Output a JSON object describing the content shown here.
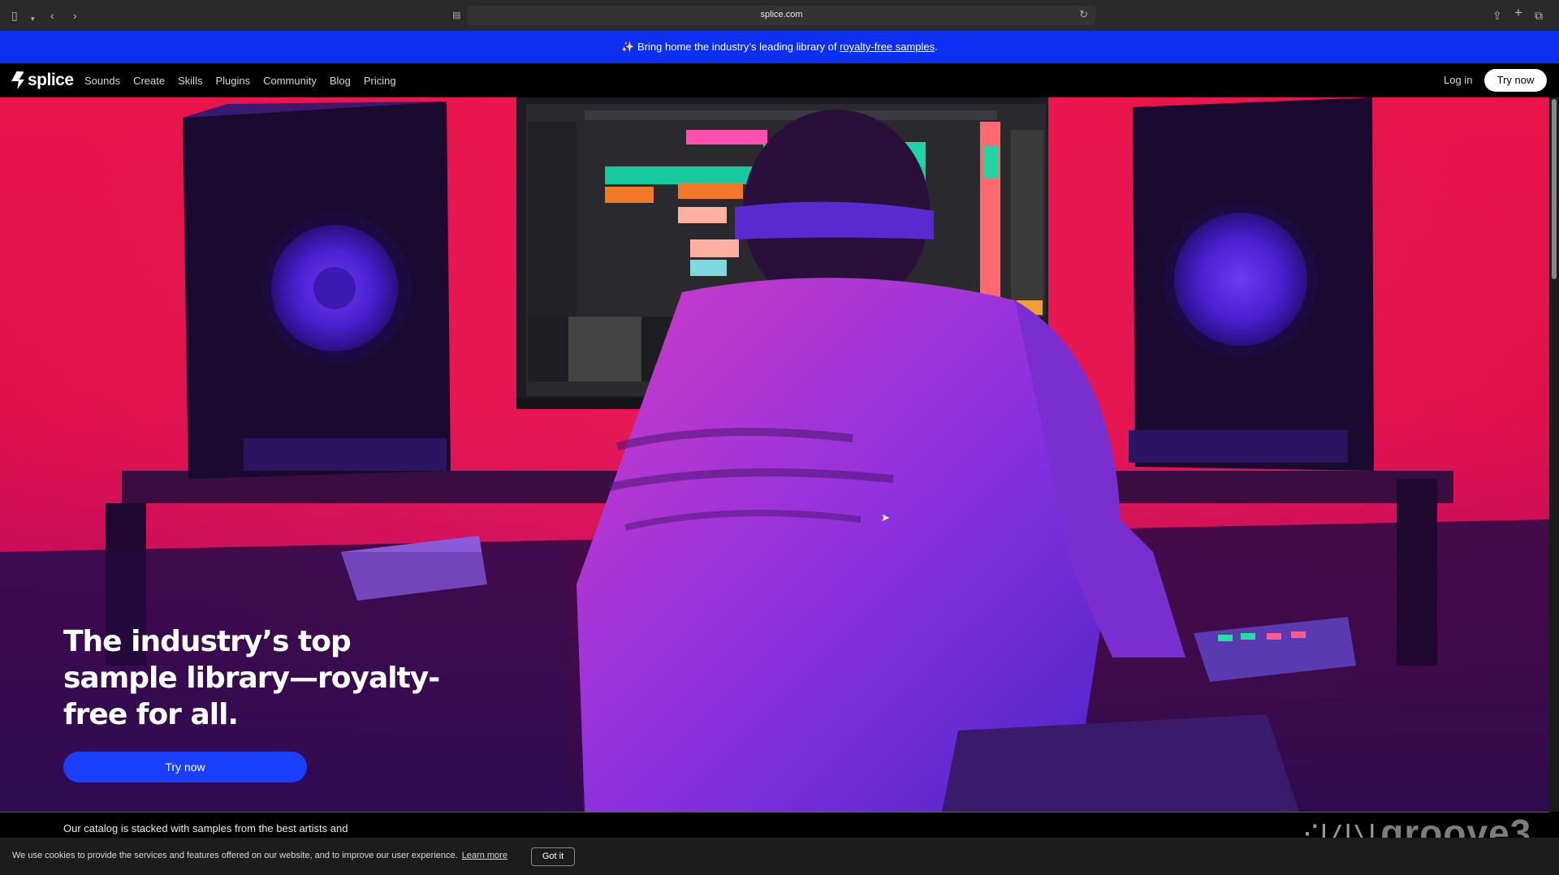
{
  "browser": {
    "url": "splice.com"
  },
  "promo": {
    "text": "Bring home the industry’s leading library of ",
    "link": "royalty-free samples",
    "suffix": "."
  },
  "nav": {
    "brand": "splice",
    "links": [
      "Sounds",
      "Create",
      "Skills",
      "Plugins",
      "Community",
      "Blog",
      "Pricing"
    ],
    "login": "Log in",
    "cta": "Try now"
  },
  "hero": {
    "title": "The industry’s top sample library—royalty-free for all.",
    "cta": "Try now",
    "subtitle": "Our catalog is stacked with samples from the best artists and"
  },
  "watermark": {
    "text": "groove3"
  },
  "cookie": {
    "text": "We use cookies to provide the services and features offered on our website, and to improve our user experience.",
    "link": "Learn more",
    "button": "Got it"
  },
  "colors": {
    "promo_bg": "#0c2ff2",
    "cta_blue": "#1a3fff",
    "hero_red": "#e8144a"
  }
}
